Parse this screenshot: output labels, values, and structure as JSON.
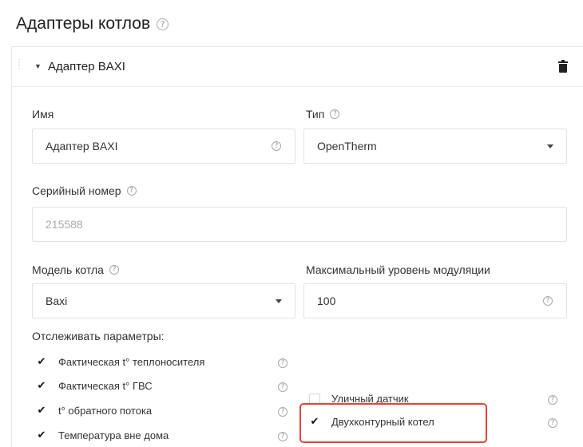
{
  "page": {
    "title": "Адаптеры котлов",
    "help_glyph": "?"
  },
  "adapter": {
    "title": "Адаптер BAXI",
    "name": {
      "label": "Имя",
      "value": "Адаптер BAXI"
    },
    "type": {
      "label": "Тип",
      "value": "OpenTherm"
    },
    "serial": {
      "label": "Серийный номер",
      "value": "215588"
    },
    "model": {
      "label": "Модель котла",
      "value": "Baxi"
    },
    "modulation": {
      "label": "Максимальный уровень модуляции",
      "value": "100"
    },
    "track": {
      "label": "Отслеживать параметры:",
      "items": [
        {
          "label": "Фактическая t° теплоносителя",
          "checked": true
        },
        {
          "label": "Фактическая t° ГВС",
          "checked": true
        },
        {
          "label": "t° обратного потока",
          "checked": true
        },
        {
          "label": "Температура вне дома",
          "checked": true
        }
      ]
    },
    "options": [
      {
        "label": "Уличный датчик",
        "checked": false
      },
      {
        "label": "Двухконтурный котел",
        "checked": true
      }
    ]
  },
  "colors": {
    "highlight": "#e0453a"
  },
  "icons": {
    "help": "help-circle-icon",
    "delete": "trash-icon",
    "collapse": "caret-down-icon",
    "drag": "drag-handle-icon"
  }
}
